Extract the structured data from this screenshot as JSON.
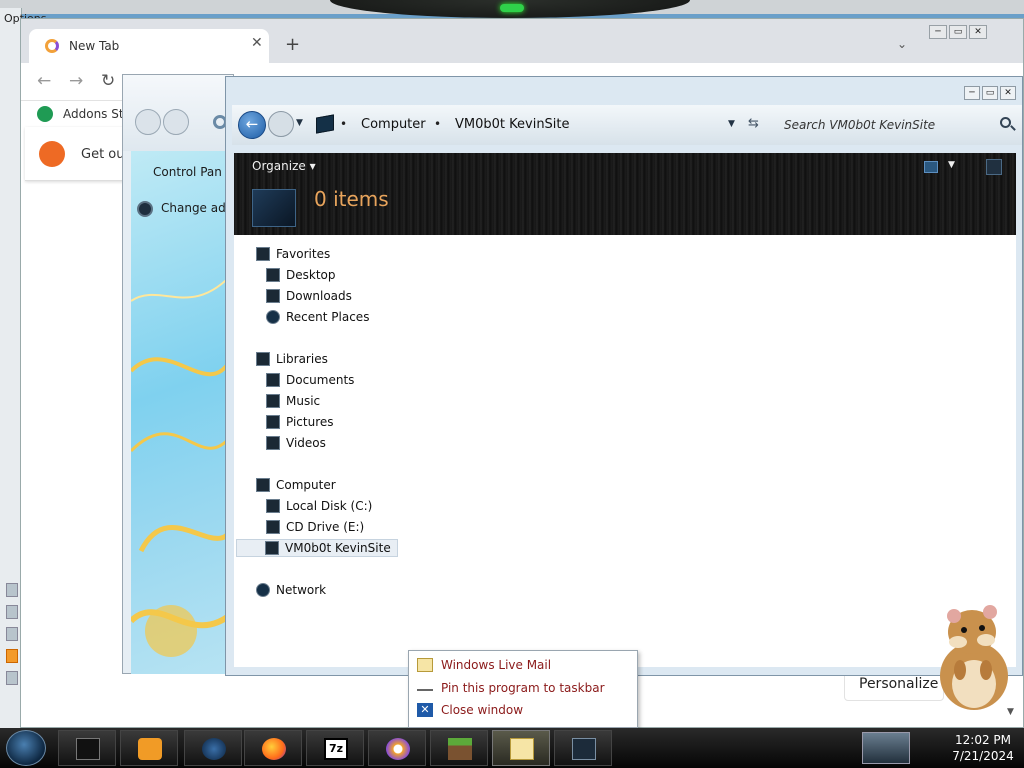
{
  "background_window": {
    "title": "Options"
  },
  "browser": {
    "tab_title": "New Tab",
    "close_tab": "✕",
    "new_tab": "+",
    "tab_menu": "⌄",
    "back": "←",
    "forward": "→",
    "reload": "↻",
    "bookmark_label": "Addons Sto",
    "banner_text": "Get our",
    "personalize_label": "Personalize",
    "scroll_down": "▼"
  },
  "control_panel": {
    "link_control_panel": "Control Pan",
    "link_change_admin": "Change adm"
  },
  "explorer": {
    "address": {
      "separator": "•",
      "crumb_computer": "Computer",
      "crumb_site": "VM0b0t KevinSite",
      "search_placeholder": "Search VM0b0t KevinSite"
    },
    "toolbar": {
      "organize": "Organize ▾",
      "item_count": "0 items"
    },
    "nav": {
      "favorites": "Favorites",
      "desktop": "Desktop",
      "downloads": "Downloads",
      "recent_places": "Recent Places",
      "libraries": "Libraries",
      "documents": "Documents",
      "music": "Music",
      "pictures": "Pictures",
      "videos": "Videos",
      "computer": "Computer",
      "local_disk": "Local Disk (C:)",
      "cd_drive": "CD Drive (E:)",
      "site": "VM0b0t KevinSite",
      "network": "Network"
    }
  },
  "context_menu": {
    "program": "Windows Live Mail",
    "pin": "Pin this program to taskbar",
    "close": "Close window"
  },
  "taskbar": {
    "time": "12:02 PM",
    "date": "7/21/2024",
    "icons": [
      "start-orb",
      "terminal",
      "media-player",
      "globe",
      "firefox",
      "7zip",
      "keepass",
      "minecraft",
      "windows-live-mail",
      "screen-app"
    ]
  },
  "colors": {
    "accent_blue": "#1e5da5",
    "menu_text": "#8b1a1a",
    "item_count_text": "#e8a45c",
    "toolbar_dark": "#151515"
  }
}
